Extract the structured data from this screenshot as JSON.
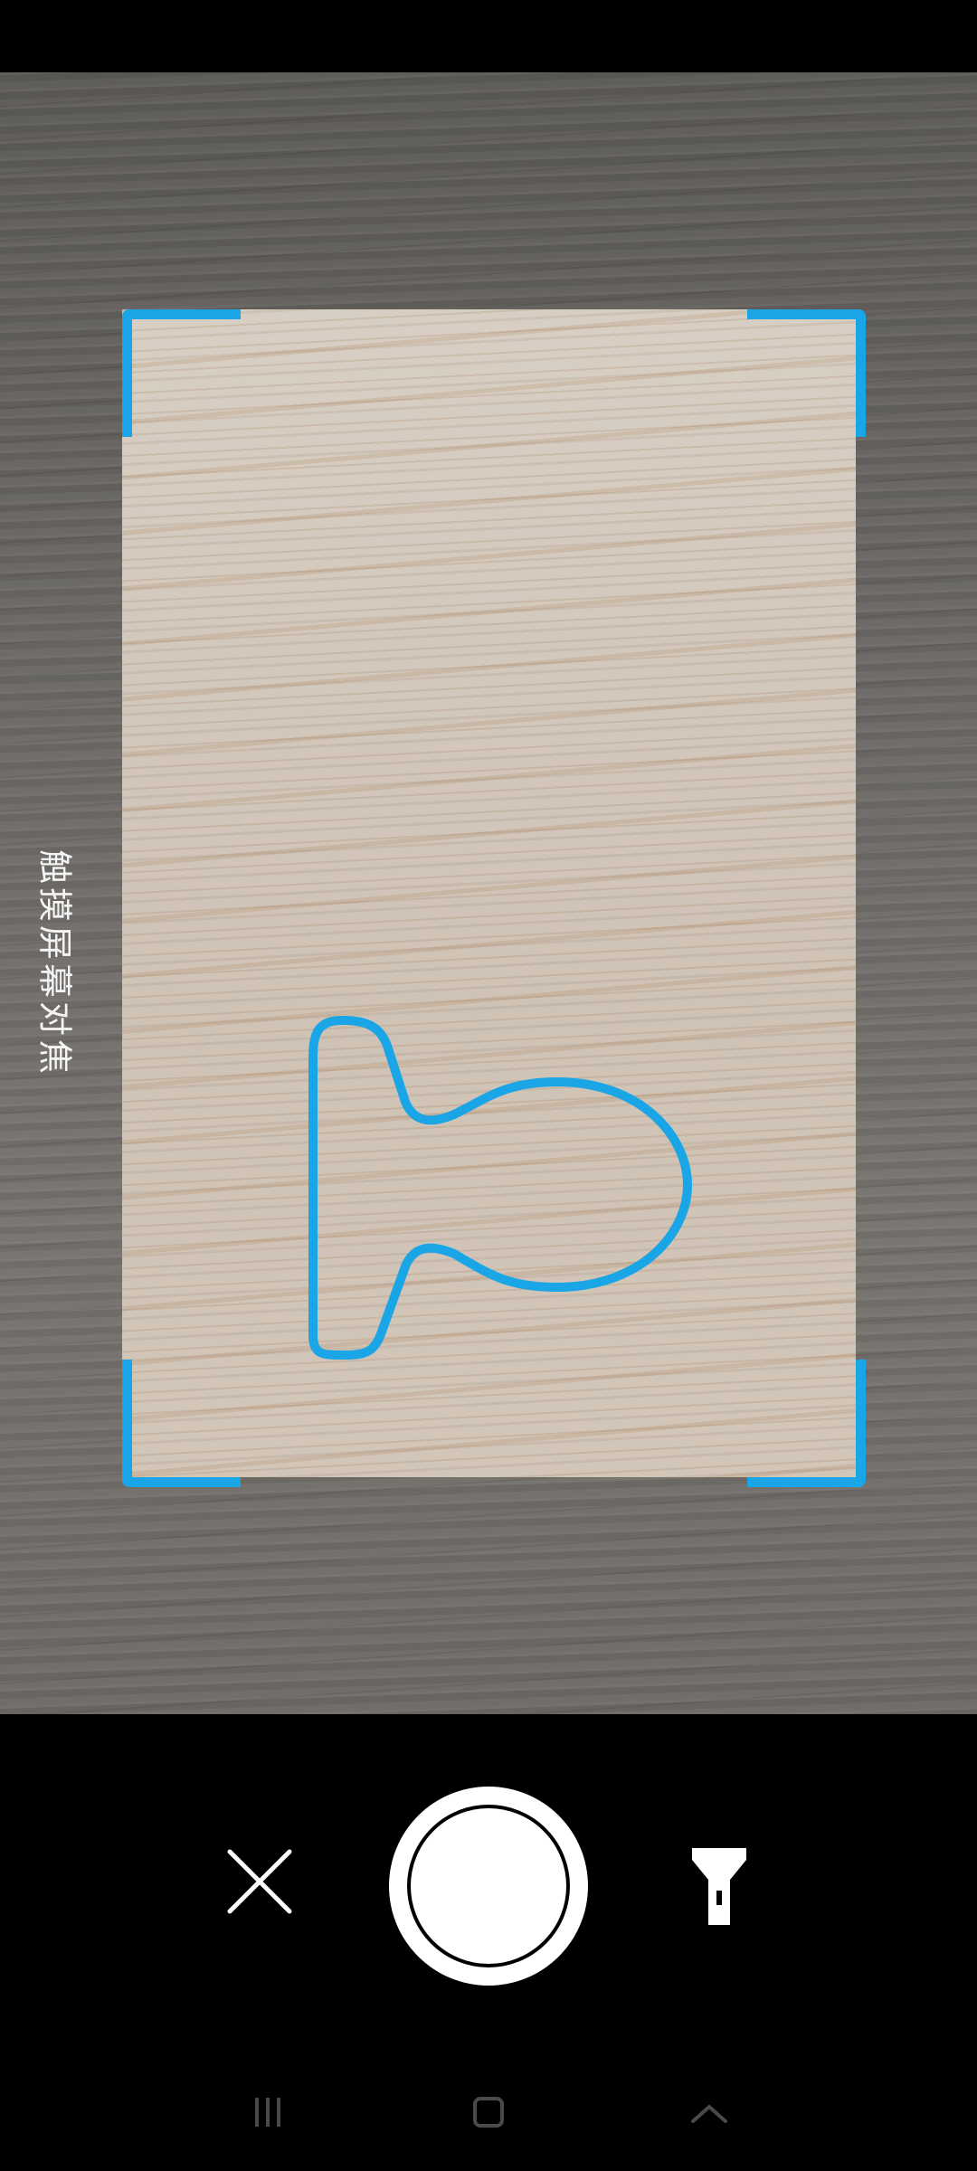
{
  "viewfinder": {
    "focus_hint": "触摸屏幕对焦",
    "frame_color": "#1aa6e6",
    "guide_shape_icon": "key-tag-outline-icon"
  },
  "controls": {
    "close_icon": "close-icon",
    "shutter_icon": "shutter-icon",
    "flashlight_icon": "flashlight-icon"
  },
  "navbar": {
    "recents_icon": "recents-icon",
    "home_icon": "home-icon",
    "back_icon": "back-chevron-icon"
  }
}
